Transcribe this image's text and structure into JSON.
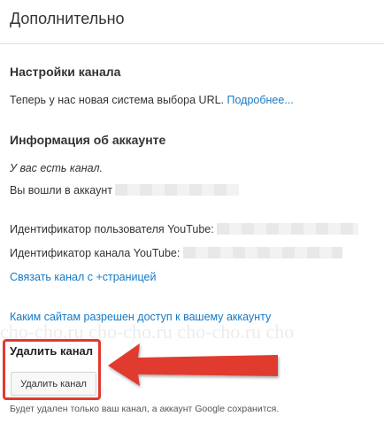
{
  "header": {
    "title": "Дополнительно"
  },
  "channel_settings": {
    "title": "Настройки канала",
    "text": "Теперь у нас новая система выбора URL.",
    "link": "Подробнее..."
  },
  "account_info": {
    "title": "Информация об аккаунте",
    "has_channel": "У вас есть канал.",
    "logged_in": "Вы вошли в аккаунт",
    "user_id_label": "Идентификатор пользователя YouTube:",
    "channel_id_label": "Идентификатор канала YouTube:",
    "link_page": "Связать канал с +страницей",
    "access_link": "Каким сайтам разрешен доступ к вашему аккаунту"
  },
  "delete_channel": {
    "title": "Удалить канал",
    "button_label": "Удалить канал",
    "note": "Будет удален только ваш канал, а аккаунт Google сохранится."
  },
  "watermark": "cho-cho.ru cho-cho.ru cho-cho.ru cho",
  "colors": {
    "link": "#167ac6",
    "highlight": "#e03a2f"
  },
  "icons": {
    "arrow": "left-arrow-icon"
  }
}
